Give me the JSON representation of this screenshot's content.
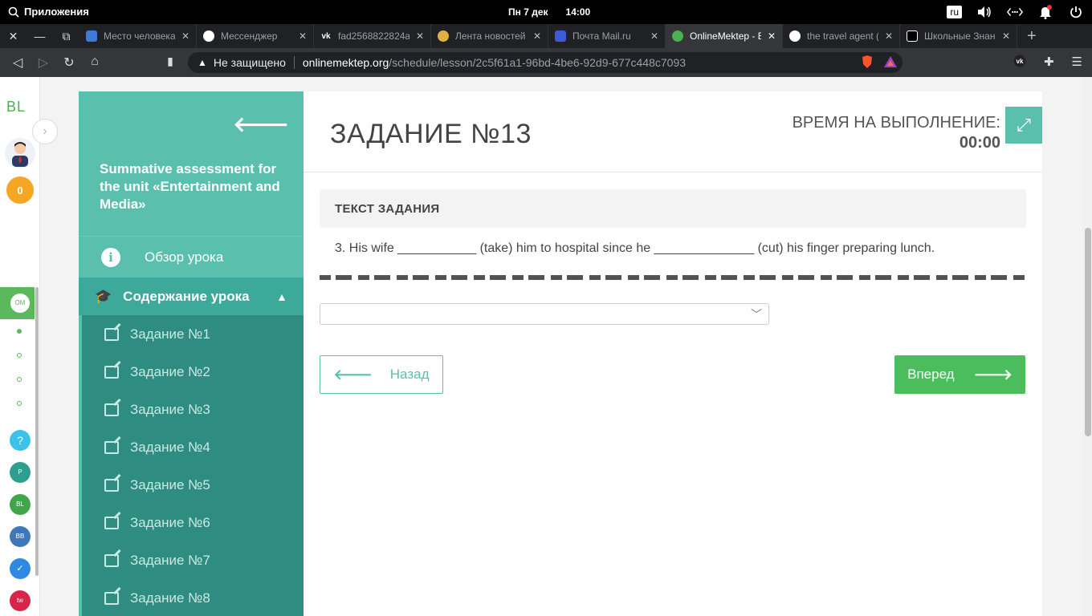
{
  "os": {
    "apps_label": "Приложения",
    "date": "Пн  7 дек",
    "time": "14:00",
    "lang": "ru"
  },
  "tabs": [
    {
      "title": "Место человека",
      "color": "#3d7bd9"
    },
    {
      "title": "Мессенджер",
      "color": "#ffffff"
    },
    {
      "title": "fad2568822824a7",
      "color": "#ffffff"
    },
    {
      "title": "Лента новостей",
      "color": "#e0b040"
    },
    {
      "title": "Почта Mail.ru",
      "color": "#3d5bd9"
    },
    {
      "title": "OnlineMektep - Е",
      "color": "#4caf50"
    },
    {
      "title": "the travel agent (",
      "color": "#ffffff"
    },
    {
      "title": "Школьные Знан",
      "color": "#000000"
    }
  ],
  "address": {
    "warning": "Не защищено",
    "host": "onlinemektep.org",
    "path": "/schedule/lesson/2c5f61a1-96bd-4be6-92d9-677c448c7093"
  },
  "rail": {
    "logo": "BL",
    "coins": "0"
  },
  "sidebar": {
    "title": "Summative assessment for the unit «Entertainment and Media»",
    "overview": "Обзор урока",
    "content": "Содержание урока",
    "items": [
      "Задание №1",
      "Задание №2",
      "Задание №3",
      "Задание №4",
      "Задание №5",
      "Задание №6",
      "Задание №7",
      "Задание №8"
    ]
  },
  "task": {
    "title": "ЗАДАНИЕ №13",
    "timer_label": "ВРЕМЯ НА ВЫПОЛНЕНИЕ:",
    "timer_value": "00:00",
    "text_header": "ТЕКСТ ЗАДАНИЯ",
    "question": "3. His wife ___________ (take) him to hospital since he ______________ (cut) his finger preparing lunch.",
    "select_value": "",
    "back_label": "Назад",
    "next_label": "Вперед"
  }
}
